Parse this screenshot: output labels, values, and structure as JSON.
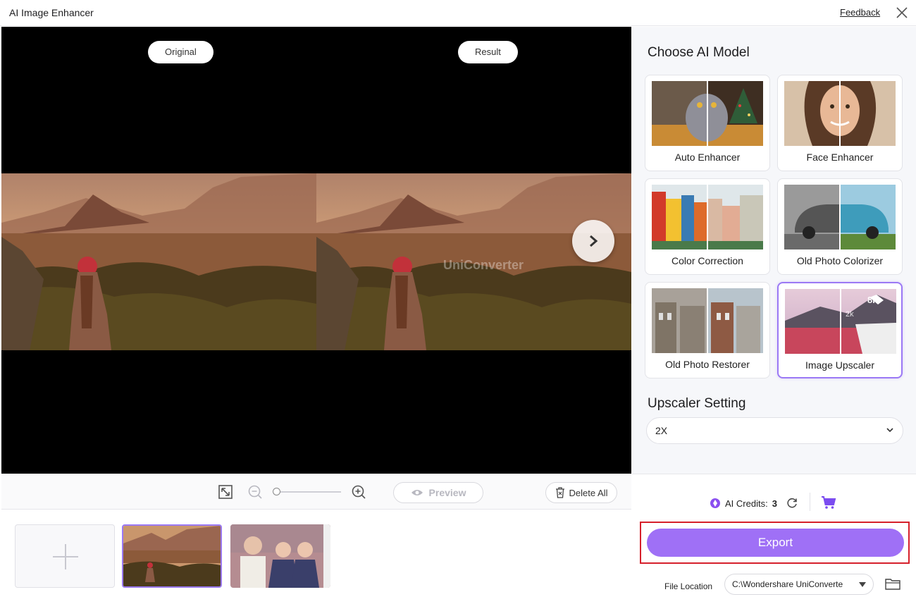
{
  "window": {
    "title": "AI Image Enhancer",
    "feedback_label": "Feedback"
  },
  "preview": {
    "original_label": "Original",
    "result_label": "Result",
    "watermark": "UniConverter"
  },
  "toolbar": {
    "preview_label": "Preview",
    "delete_all_label": "Delete All",
    "zoom_level": 0
  },
  "models": {
    "title": "Choose AI Model",
    "items": [
      {
        "label": "Auto Enhancer",
        "selected": false
      },
      {
        "label": "Face Enhancer",
        "selected": false
      },
      {
        "label": "Color Correction",
        "selected": false
      },
      {
        "label": "Old Photo Colorizer",
        "selected": false
      },
      {
        "label": "Old Photo Restorer",
        "selected": false
      },
      {
        "label": "Image Upscaler",
        "selected": true
      }
    ],
    "upscaler_badges": [
      "8k",
      "2k"
    ]
  },
  "upscaler": {
    "title": "Upscaler Setting",
    "value": "2X"
  },
  "footer": {
    "credits_label": "AI Credits:",
    "credits_value": "3",
    "export_label": "Export",
    "file_location_label": "File Location",
    "file_location_value": "C:\\Wondershare UniConverte"
  },
  "colors": {
    "accent": "#9f70f6",
    "highlight": "#d6202b"
  }
}
